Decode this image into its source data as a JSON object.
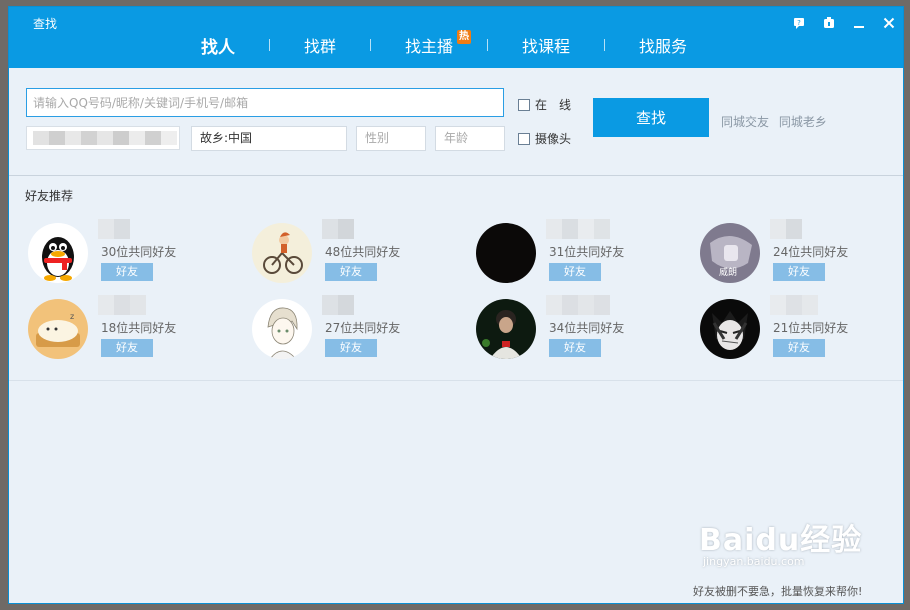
{
  "window": {
    "title": "查找"
  },
  "tabs": [
    {
      "label": "找人",
      "active": true
    },
    {
      "label": "找群",
      "active": false
    },
    {
      "label": "找主播",
      "active": false,
      "badge": "热"
    },
    {
      "label": "找课程",
      "active": false
    },
    {
      "label": "找服务",
      "active": false
    }
  ],
  "controls": {
    "feedback_icon": "feedback-icon",
    "skin_icon": "skin-icon",
    "minimize_icon": "minimize-icon",
    "close_icon": "close-icon"
  },
  "search": {
    "placeholder": "请输入QQ号码/昵称/关键词/手机号/邮箱",
    "hometown": "故乡:中国",
    "gender_placeholder": "性别",
    "age_placeholder": "年龄",
    "online_label": "在　线",
    "camera_label": "摄像头",
    "button_label": "查找",
    "quick_links": [
      "同城交友",
      "同城老乡"
    ]
  },
  "recommend": {
    "title": "好友推荐",
    "friend_button": "好友",
    "cards": [
      {
        "mutual": "30位共同好友",
        "avatar": "qq-penguin-avatar"
      },
      {
        "mutual": "48位共同好友",
        "avatar": "bicycle-cartoon-avatar"
      },
      {
        "mutual": "31位共同好友",
        "avatar": "black-avatar"
      },
      {
        "mutual": "24位共同好友",
        "avatar": "photo-avatar",
        "avatar_text": "威朗"
      },
      {
        "mutual": "18位共同好友",
        "avatar": "sleeping-cat-avatar"
      },
      {
        "mutual": "27位共同好友",
        "avatar": "anime-boy-avatar"
      },
      {
        "mutual": "34位共同好友",
        "avatar": "dark-photo-avatar"
      },
      {
        "mutual": "21位共同好友",
        "avatar": "anime-character-avatar"
      }
    ]
  },
  "watermark": {
    "logo": "Baidu经验",
    "sub": "jingyan.baidu.com"
  },
  "footer": {
    "text": "好友被删不要急，批量恢复来帮你!"
  },
  "colors": {
    "accent": "#0a9ae3",
    "friend_button": "#86bde6",
    "badge": "#f07c14"
  }
}
